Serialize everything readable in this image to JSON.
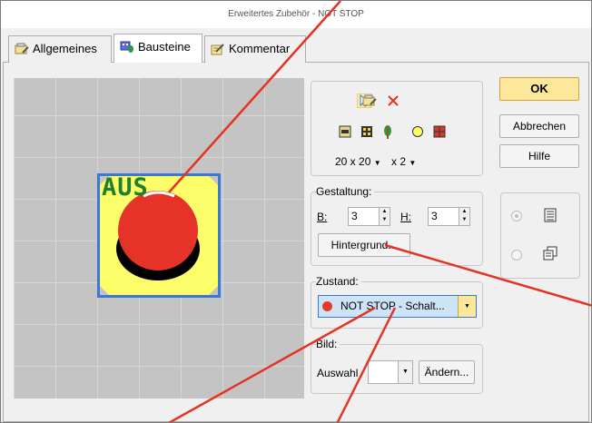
{
  "window": {
    "title": "Erweitertes Zubehör - NOT STOP"
  },
  "tabs": [
    {
      "label": "Allgemeines",
      "icon": "properties-icon",
      "active": false
    },
    {
      "label": "Bausteine",
      "icon": "blocks-icon",
      "active": true
    },
    {
      "label": "Kommentar",
      "icon": "comment-icon",
      "active": false
    }
  ],
  "preview": {
    "label_text": "AUS"
  },
  "tools": {
    "top_icons": [
      "pointer-icon",
      "properties-icon",
      "delete-icon"
    ],
    "block_icons": [
      "signal-block-icon",
      "grid-block-icon",
      "tree-block-icon",
      "circle-block-icon",
      "red-grid-block-icon"
    ],
    "size_select": "20 x 20",
    "zoom_select": "x 2"
  },
  "gestaltung": {
    "label": "Gestaltung:",
    "b_label": "B:",
    "b_value": "3",
    "h_label": "H:",
    "h_value": "3",
    "background_button": "Hintergrund..."
  },
  "zustand": {
    "label": "Zustand:",
    "selected": "NOT STOP - Schalt...",
    "status_color": "#e53a2a"
  },
  "bild": {
    "label": "Bild:",
    "auswahl_label": "Auswahl",
    "auswahl_value": "",
    "change_button": "Ändern..."
  },
  "actions": {
    "ok": "OK",
    "cancel": "Abbrechen",
    "help": "Hilfe"
  },
  "view_options": {
    "icons": [
      "list-view-icon",
      "copy-view-icon"
    ],
    "selected_index": 0
  },
  "colors": {
    "accent": "#3a78d2",
    "ok_button": "#fde79a",
    "block_yellow": "#fdfd6a",
    "stop_red": "#e53a2a",
    "text_green": "#1f7f2f",
    "annotation_line": "#e53323"
  }
}
